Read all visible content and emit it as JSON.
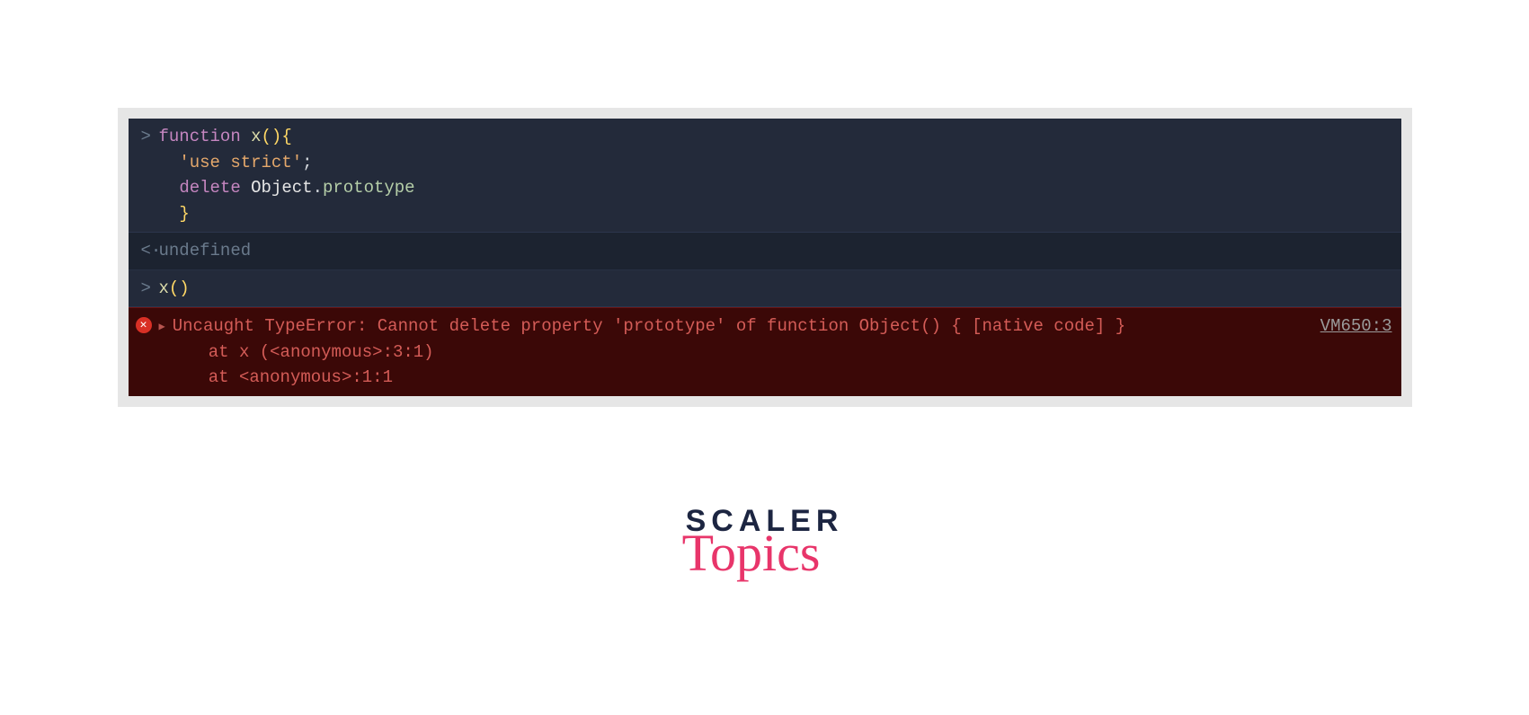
{
  "console": {
    "input1": {
      "prompt": ">",
      "l1_kw": "function",
      "l1_name": " x",
      "l1_paren": "(){",
      "l2_indent": "  ",
      "l2_str": "'use strict'",
      "l2_semi": ";",
      "l3_indent": "  ",
      "l3_delete": "delete",
      "l3_sp": " ",
      "l3_obj": "Object",
      "l3_dot": ".",
      "l3_proto": "prototype",
      "l4_indent": "  ",
      "l4_brace": "}"
    },
    "output1": {
      "prompt": "<·",
      "text": "undefined"
    },
    "input2": {
      "prompt": ">",
      "name": "x",
      "paren": "()"
    },
    "error": {
      "icon": "✕",
      "expand": "▶",
      "message": "Uncaught TypeError: Cannot delete property 'prototype' of function Object() { [native code] }",
      "source": "VM650:3",
      "stack1": "at x (<anonymous>:3:1)",
      "stack2": "at <anonymous>:1:1"
    }
  },
  "logo": {
    "scaler": "SCALER",
    "topics": "Topics"
  }
}
